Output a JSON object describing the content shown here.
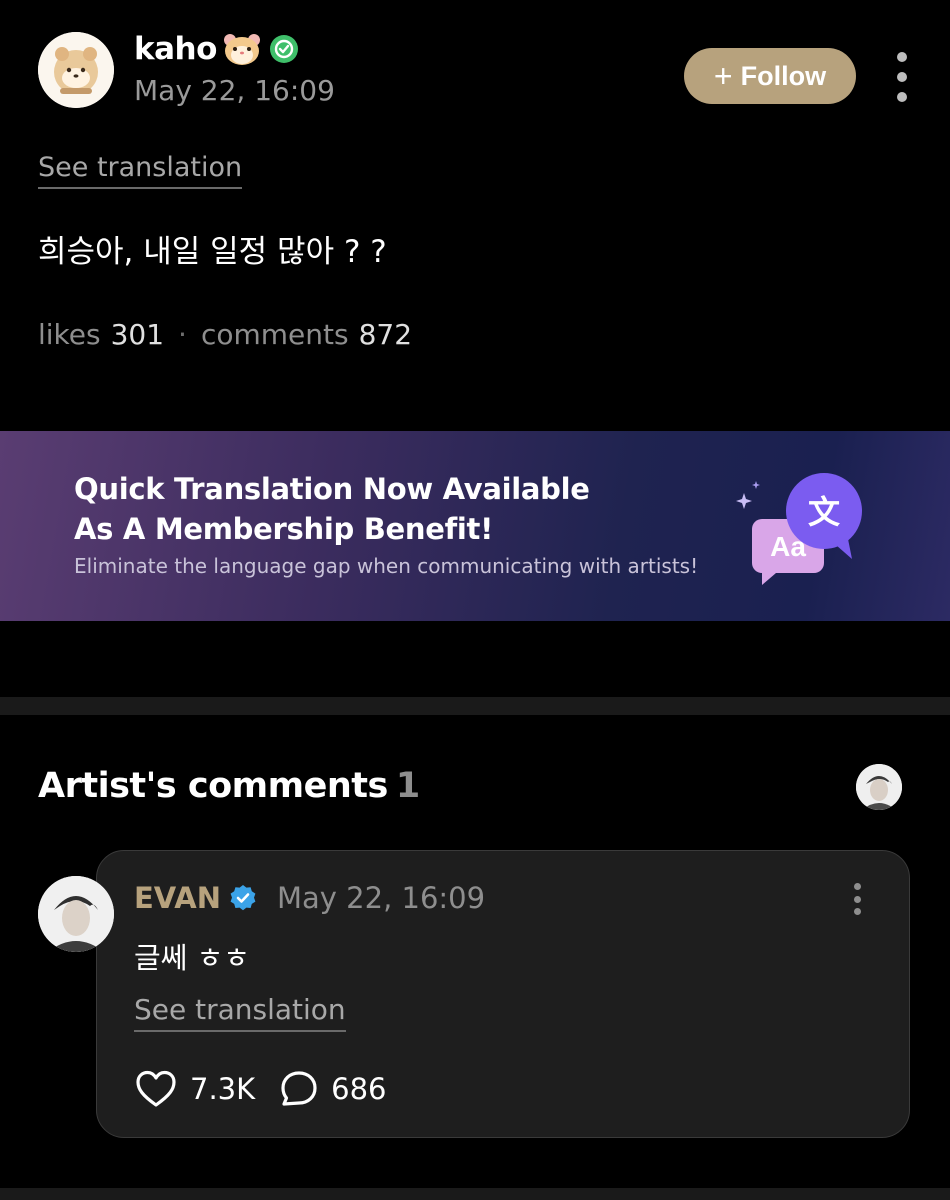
{
  "post": {
    "author": "kaho",
    "date": "May 22, 16:09",
    "follow_label": "Follow",
    "see_translation": "See translation",
    "body": "희승아, 내일 일정 많아 ? ?",
    "likes_label": "likes",
    "likes_count": "301",
    "separator": "·",
    "comments_label": "comments",
    "comments_count": "872"
  },
  "banner": {
    "title_line1": "Quick Translation Now Available",
    "title_line2": "As A Membership Benefit!",
    "subtitle": "Eliminate the language gap when communicating with artists!",
    "icon_text_1": "Aa",
    "icon_text_2": "文"
  },
  "artist_comments": {
    "title": "Artist's comments",
    "count": "1",
    "comment": {
      "author": "EVAN",
      "date": "May 22, 16:09",
      "body": "글쎄 ㅎㅎ",
      "see_translation": "See translation",
      "likes": "7.3K",
      "replies": "686"
    }
  },
  "colors": {
    "background": "#000000",
    "accent_gold": "#b7a27d",
    "verified_green": "#3fbf6a",
    "verified_blue": "#3ba3e8",
    "muted_text": "#8e8e8e",
    "card_background": "#1e1e1e"
  },
  "icons": {
    "menu": "more-vertical-icon",
    "verified": "verified-badge-icon",
    "like": "heart-outline-icon",
    "reply": "comment-bubble-icon",
    "translate": "translate-icon"
  }
}
